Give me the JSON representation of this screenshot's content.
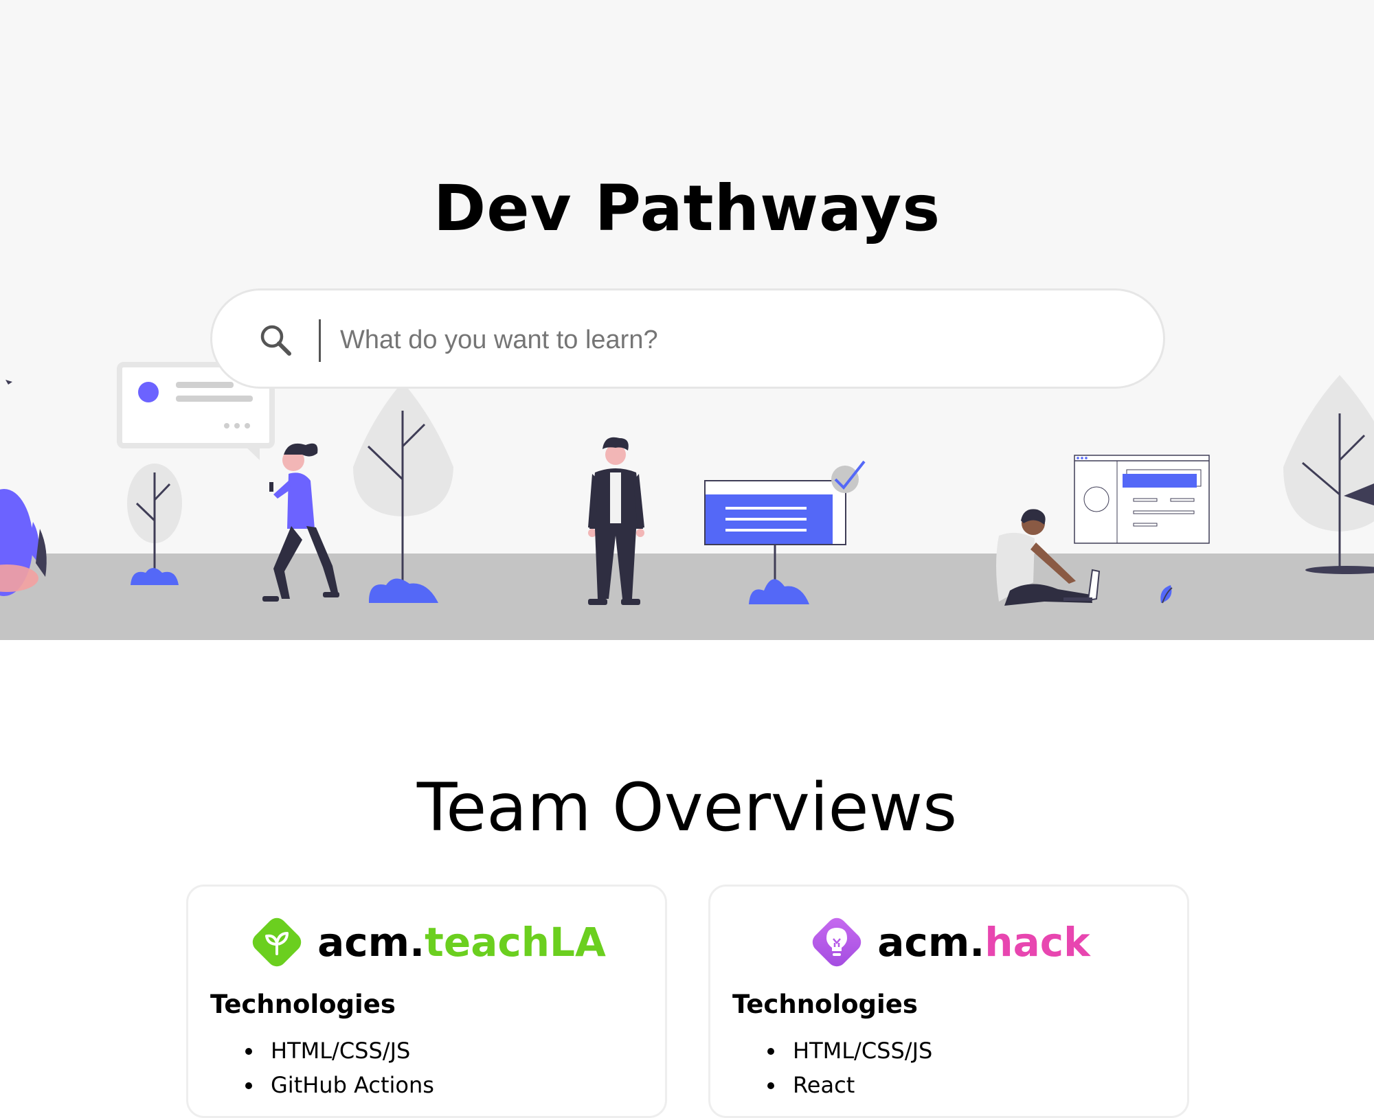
{
  "hero": {
    "title": "Dev Pathways",
    "search": {
      "placeholder": "What do you want to learn?",
      "value": "",
      "icon": "search-icon"
    },
    "colors": {
      "background": "#f7f7f7",
      "ground": "#c4c4c4",
      "accent": "#5468f7",
      "figure_purple": "#6c63ff"
    }
  },
  "team_overviews": {
    "title": "Team Overviews",
    "cards": [
      {
        "logo_icon": "sprout-icon",
        "logo_prefix": "acm.",
        "logo_name": "teachLA",
        "logo_color": "#6bcf1f",
        "section_heading": "Technologies",
        "technologies": [
          "HTML/CSS/JS",
          "GitHub Actions"
        ]
      },
      {
        "logo_icon": "lightbulb-icon",
        "logo_prefix": "acm.",
        "logo_name": "hack",
        "logo_color": "#e846b0",
        "section_heading": "Technologies",
        "technologies": [
          "HTML/CSS/JS",
          "React"
        ]
      }
    ]
  }
}
